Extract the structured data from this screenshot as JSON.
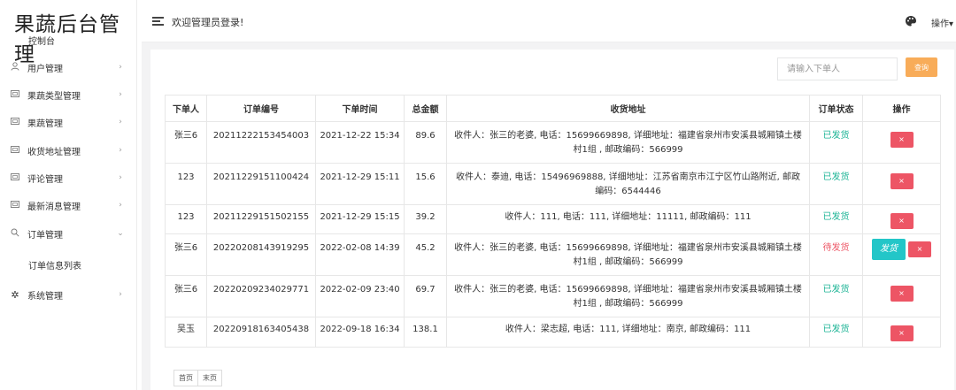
{
  "sidebar": {
    "logo": "果蔬后台管理",
    "dashboard": "控制台",
    "items": [
      {
        "label": "用户管理",
        "icon": "user-icon"
      },
      {
        "label": "果蔬类型管理",
        "icon": "folder-icon"
      },
      {
        "label": "果蔬管理",
        "icon": "folder-icon"
      },
      {
        "label": "收货地址管理",
        "icon": "folder-icon"
      },
      {
        "label": "评论管理",
        "icon": "folder-icon"
      },
      {
        "label": "最新消息管理",
        "icon": "folder-icon"
      },
      {
        "label": "订单管理",
        "icon": "search-icon"
      },
      {
        "label": "系统管理",
        "icon": "gear-icon"
      }
    ],
    "sub_item": "订单信息列表"
  },
  "header": {
    "welcome": "欢迎管理员登录!",
    "ops": "操作▾"
  },
  "search": {
    "placeholder": "请输入下单人",
    "button": "查询"
  },
  "table": {
    "headers": [
      "下单人",
      "订单编号",
      "下单时间",
      "总金额",
      "收货地址",
      "订单状态",
      "操作"
    ],
    "rows": [
      {
        "user": "张三6",
        "order_no": "20211222153454003",
        "time": "2021-12-22 15:34",
        "amount": "89.6",
        "address": "收件人：张三的老婆, 电话：15699669898, 详细地址：福建省泉州市安溪县城厢镇土楼村1组 , 邮政编码：566999",
        "status": "已发货"
      },
      {
        "user": "123",
        "order_no": "20211229151100424",
        "time": "2021-12-29 15:11",
        "amount": "15.6",
        "address": "收件人：泰迪, 电话：15496969888, 详细地址：江苏省南京市江宁区竹山路附近, 邮政编码：6544446",
        "status": "已发货"
      },
      {
        "user": "123",
        "order_no": "20211229151502155",
        "time": "2021-12-29 15:15",
        "amount": "39.2",
        "address": "收件人：111, 电话：111, 详细地址：11111, 邮政编码：111",
        "status": "已发货"
      },
      {
        "user": "张三6",
        "order_no": "20220208143919295",
        "time": "2022-02-08 14:39",
        "amount": "45.2",
        "address": "收件人：张三的老婆, 电话：15699669898, 详细地址：福建省泉州市安溪县城厢镇土楼村1组 , 邮政编码：566999",
        "status": "待发货"
      },
      {
        "user": "张三6",
        "order_no": "20220209234029771",
        "time": "2022-02-09 23:40",
        "amount": "69.7",
        "address": "收件人：张三的老婆, 电话：15699669898, 详细地址：福建省泉州市安溪县城厢镇土楼村1组 , 邮政编码：566999",
        "status": "已发货"
      },
      {
        "user": "吴玉",
        "order_no": "20220918163405438",
        "time": "2022-09-18 16:34",
        "amount": "138.1",
        "address": "收件人：梁志超, 电话：111, 详细地址：南京, 邮政编码：111",
        "status": "已发货"
      }
    ],
    "delete_label": "×",
    "ship_label": "发货"
  },
  "pager": {
    "first": "首页",
    "last": "末页"
  },
  "colors": {
    "shipped": "#1ab394",
    "pending": "#ed5565",
    "delete": "#ed5565",
    "ship": "#23c6c8",
    "search": "#f8ac59"
  }
}
